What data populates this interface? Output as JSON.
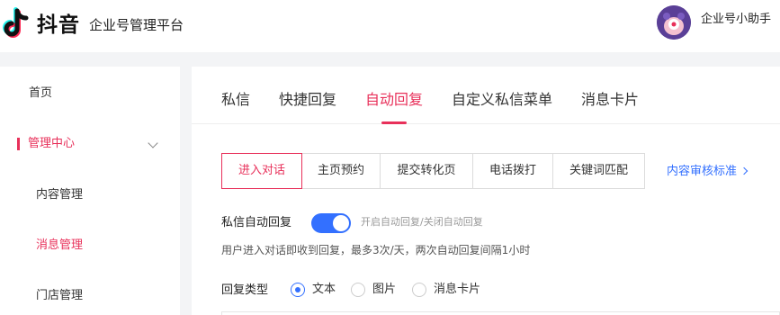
{
  "header": {
    "brand": "抖音",
    "platform": "企业号管理平台",
    "user_name": "企业号小助手"
  },
  "sidebar": {
    "items": [
      {
        "label": "首页"
      },
      {
        "label": "管理中心"
      },
      {
        "label": "内容管理"
      },
      {
        "label": "消息管理"
      },
      {
        "label": "门店管理"
      }
    ]
  },
  "main": {
    "tabs": [
      {
        "label": "私信"
      },
      {
        "label": "快捷回复"
      },
      {
        "label": "自动回复"
      },
      {
        "label": "自定义私信菜单"
      },
      {
        "label": "消息卡片"
      }
    ],
    "segments": [
      {
        "label": "进入对话"
      },
      {
        "label": "主页预约"
      },
      {
        "label": "提交转化页"
      },
      {
        "label": "电话拨打"
      },
      {
        "label": "关键词匹配"
      }
    ],
    "audit_link": "内容审核标准",
    "auto_reply_label": "私信自动回复",
    "toggle_hint": "开启自动回复/关闭自动回复",
    "description": "用户进入对话即收到回复，最多3次/天，两次自动回复间隔1小时",
    "reply_type_label": "回复类型",
    "reply_types": [
      {
        "label": "文本"
      },
      {
        "label": "图片"
      },
      {
        "label": "消息卡片"
      }
    ]
  },
  "colors": {
    "accent": "#e8305a",
    "link": "#3370ff",
    "toggle_on": "#3370ff"
  },
  "state": {
    "active_tab": "自动回复",
    "active_segment": "进入对话",
    "auto_reply_enabled": true,
    "selected_reply_type": "文本"
  }
}
